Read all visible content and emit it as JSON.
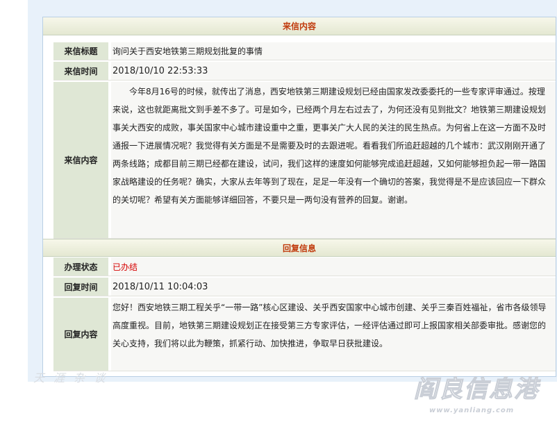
{
  "letter": {
    "section_title": "来信内容",
    "title_label": "来信标题",
    "title_value": "询问关于西安地铁第三期规划批复的事情",
    "time_label": "来信时间",
    "time_value": "2018/10/10 22:53:33",
    "content_label": "来信内容",
    "content_value": "今年8月16号的时候，就传出了消息，西安地铁第三期建设规划已经由国家发改委委托的一些专家评审通过。按理来说，这也就距离批文到手差不多了。可是如今，已经两个月左右过去了，为何还没有见到批文？地铁第三期建设规划事关大西安的成败，事关国家中心城市建设重中之重，更事关广大人民的关注的民生热点。为何省上在这一方面不及时通报一下进展情况呢？我觉得有关方面是不是需要及时的去跟进呢。看看我们所追赶超越的几个城市：武汉刚刚开通了两条线路；成都目前三期已经都在建设，试问，我们这样的速度如何能够完成追赶超越，又如何能够担负起一带一路国家战略建设的任务呢？确实，大家从去年等到了现在，足足一年没有一个确切的答案，我觉得是不是应该回应一下群众的关切呢？希望有关方面能够详细回答，不要只是一两句没有营养的回复。谢谢。"
  },
  "reply": {
    "section_title": "回复信息",
    "status_label": "办理状态",
    "status_value": "已办结",
    "time_label": "回复时间",
    "time_value": "2018/10/11 10:04:03",
    "content_label": "回复内容",
    "content_value": "您好！西安地铁三期工程关乎“一带一路”核心区建设、关乎西安国家中心城市创建、关乎三秦百姓福祉，省市各级领导高度重视。目前，地铁第三期建设规划正在接受第三方专家评估，一经评估通过即可上报国家相关部委审批。感谢您的关心支持，我们将以此为鞭策，抓紧行动、加快推进，争取早日获批建设。"
  },
  "colors": {
    "section_title": "#c0390b",
    "status": "#d60000",
    "label_bg": "#dfe7d5",
    "frame_bg": "#e8f1fa"
  },
  "watermarks": {
    "left_text": "天 涯 杂 谈",
    "right_text": "阎良信息港",
    "right_url": "www.yanliang.com"
  }
}
